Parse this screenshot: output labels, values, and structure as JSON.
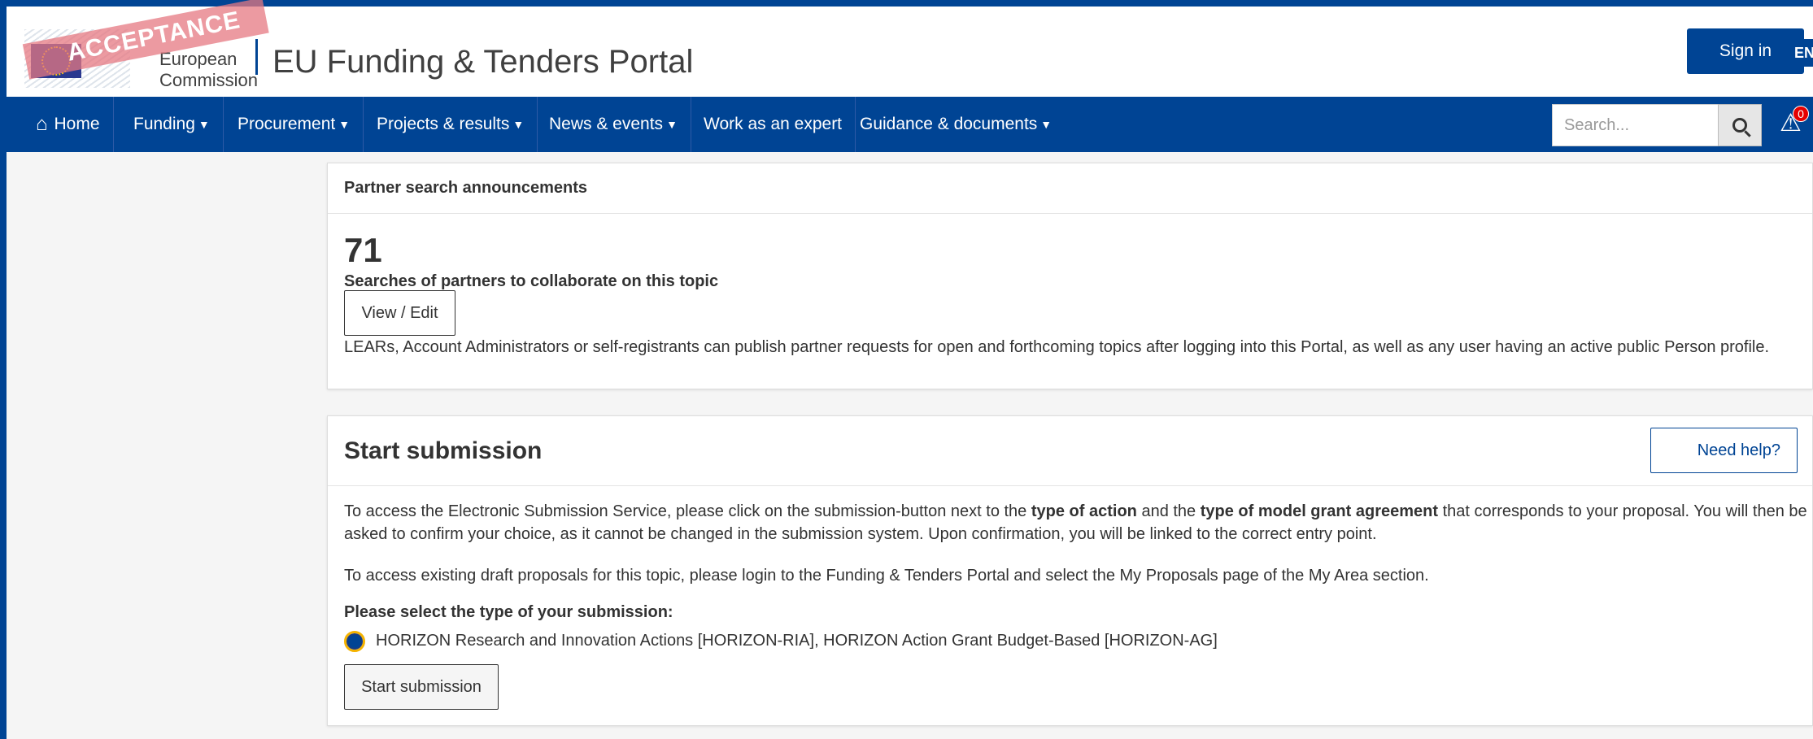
{
  "header": {
    "logo_stamp": "ACCEPTANCE",
    "logo_line1": "European",
    "logo_line2": "Commission",
    "portal_title": "EU Funding & Tenders Portal",
    "sign_in": "Sign in",
    "language": "EN"
  },
  "nav": {
    "items": [
      {
        "label": "Home",
        "icon": "home-icon"
      },
      {
        "label": "Funding",
        "dropdown": true
      },
      {
        "label": "Procurement",
        "dropdown": true
      },
      {
        "label": "Projects & results",
        "dropdown": true
      },
      {
        "label": "News & events",
        "dropdown": true
      },
      {
        "label": "Work as an expert"
      },
      {
        "label": "Guidance & documents",
        "dropdown": true
      }
    ],
    "search_placeholder": "Search...",
    "notifications_count": "0"
  },
  "partner_search": {
    "title": "Partner search announcements",
    "count": "71",
    "count_label": "Searches of partners to collaborate on this topic",
    "button": "View / Edit",
    "note": "LEARs, Account Administrators or self-registrants can publish partner requests for open and forthcoming topics after logging into this Portal, as well as any user having an active public Person profile."
  },
  "start_submission": {
    "title": "Start submission",
    "need_help": "Need help?",
    "para1_a": "To access the Electronic Submission Service, please click on the submission-button next to the ",
    "para1_b": "type of action",
    "para1_c": " and the ",
    "para1_d": "type of model grant agreement",
    "para1_e": " that corresponds to your proposal. You will then be asked to confirm your choice, as it cannot be changed in the submission system. Upon confirmation, you will be linked to the correct entry point.",
    "para2": "To access existing draft proposals for this topic, please login to the Funding & Tenders Portal and select the My Proposals page of the My Area section.",
    "select_label": "Please select the type of your submission:",
    "option_label": "HORIZON Research and Innovation Actions [HORIZON-RIA], HORIZON Action Grant Budget-Based [HORIZON-AG]",
    "option_selected": true,
    "button": "Start submission"
  },
  "colors": {
    "brand_blue": "#004494",
    "alert_red": "#e60000",
    "focus_yellow": "#f5b300"
  }
}
